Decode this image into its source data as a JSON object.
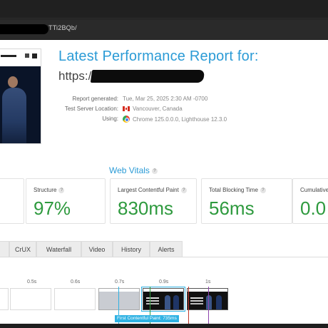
{
  "browser": {
    "address_text": "TTi2BQb/"
  },
  "report": {
    "title": "Latest Performance Report for:",
    "url_prefix": "https://",
    "meta": [
      {
        "label": "Report generated:",
        "value": "Tue, Mar 25, 2025 2:30 AM -0700"
      },
      {
        "label": "Test Server Location:",
        "value": "Vancouver, Canada",
        "icon": "canada-flag-icon"
      },
      {
        "label": "Using:",
        "value": "Chrome 125.0.0.0, Lighthouse 12.3.0",
        "icon": "chrome-icon"
      }
    ]
  },
  "vitals": {
    "title": "Web Vitals",
    "help_glyph": "?",
    "cards": [
      {
        "label": "Structure",
        "value": "97%"
      },
      {
        "label": "Largest Contentful Paint",
        "value": "830ms"
      },
      {
        "label": "Total Blocking Time",
        "value": "56ms"
      },
      {
        "label": "Cumulative",
        "value": "0.0"
      }
    ],
    "value_color": "#2e9a3e"
  },
  "tabs": [
    "CrUX",
    "Waterfall",
    "Video",
    "History",
    "Alerts"
  ],
  "filmstrip": {
    "timestamps": [
      "0.5s",
      "0.6s",
      "0.7s",
      "0.9s",
      "1s"
    ],
    "fcp_label": "First Contentful Paint: 735ms"
  },
  "colors": {
    "accent": "#2b9bd6",
    "good": "#2e9a3e",
    "fcp": "#2fb2e3"
  }
}
